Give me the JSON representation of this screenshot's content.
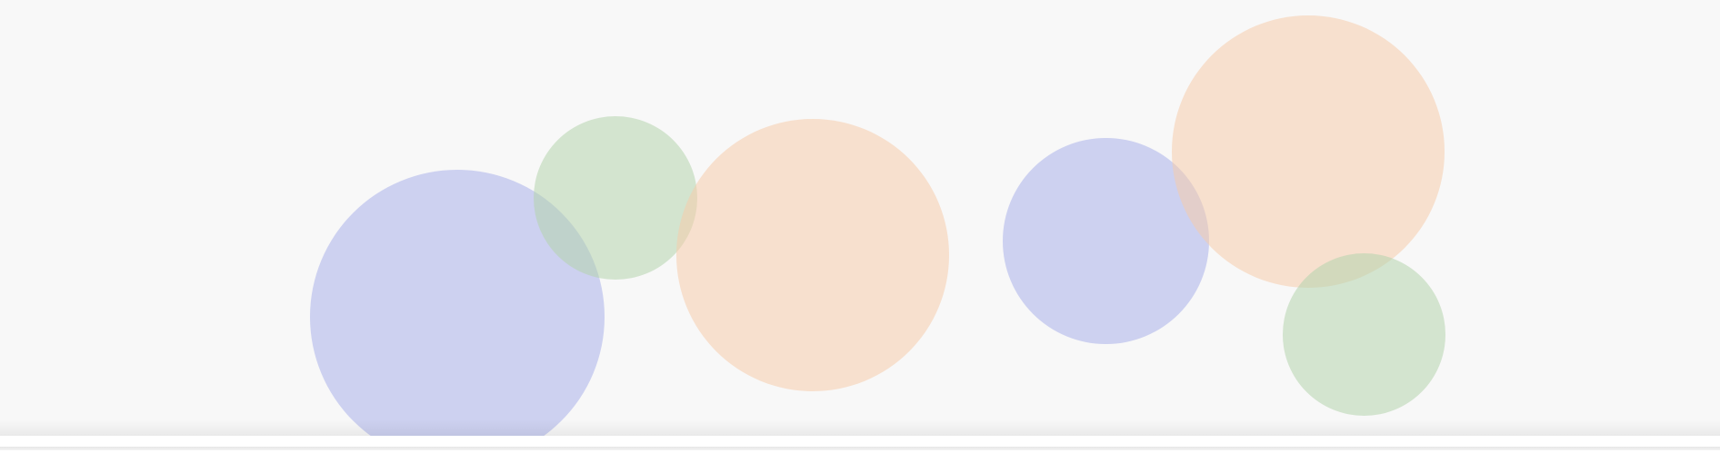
{
  "colors": {
    "background": "#f8f8f8",
    "blue_bubble": "#aab0ea",
    "peach_bubble": "#f6ccac",
    "green_bubble": "#b5d3ad",
    "strip": "#ffffff"
  },
  "bubbles": [
    {
      "name": "blue-bubble-left",
      "color": "blue"
    },
    {
      "name": "green-bubble-left",
      "color": "green"
    },
    {
      "name": "peach-bubble-center",
      "color": "peach"
    },
    {
      "name": "blue-bubble-right",
      "color": "blue"
    },
    {
      "name": "peach-bubble-right",
      "color": "peach"
    },
    {
      "name": "green-bubble-right",
      "color": "green"
    }
  ]
}
